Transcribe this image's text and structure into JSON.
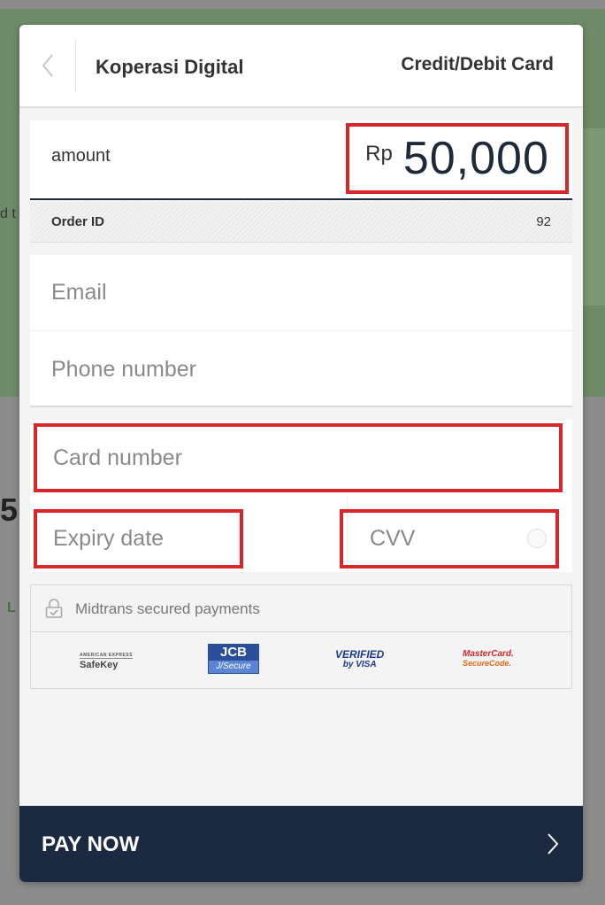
{
  "background": {
    "text1": "d t",
    "text2": "5.",
    "text3": "L"
  },
  "header": {
    "merchant_name": "Koperasi Digital",
    "payment_method": "Credit/Debit Card",
    "back_icon": "chevron-left-icon"
  },
  "amount": {
    "label": "amount",
    "currency": "Rp",
    "value": "50,000"
  },
  "order": {
    "label": "Order ID",
    "value": "92"
  },
  "contact": {
    "email_placeholder": "Email",
    "phone_placeholder": "Phone number"
  },
  "card": {
    "number_placeholder": "Card number",
    "expiry_placeholder": "Expiry date",
    "cvv_placeholder": "CVV"
  },
  "secure": {
    "text": "Midtrans secured payments",
    "icon": "lock-icon",
    "logos": {
      "safekey_top": "AMERICAN EXPRESS",
      "safekey": "SafeKey",
      "jcb_top": "JCB",
      "jcb_bottom": "J/Secure",
      "visa_top": "VERIFIED",
      "visa_bottom": "by VISA",
      "mc_top": "MasterCard.",
      "mc_bottom": "SecureCode."
    }
  },
  "pay": {
    "label": "PAY NOW",
    "icon": "chevron-right-icon"
  },
  "colors": {
    "navy": "#1b2a40",
    "highlight": "#d9262b",
    "background_green": "#6e8a68"
  }
}
